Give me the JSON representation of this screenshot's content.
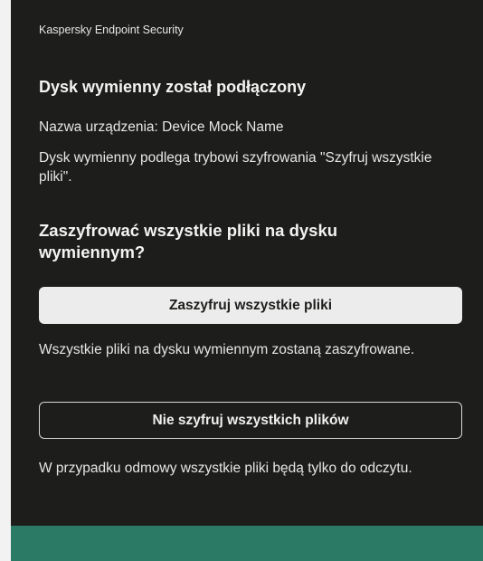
{
  "window": {
    "app_title": "Kaspersky Endpoint Security"
  },
  "notification": {
    "heading": "Dysk wymienny został podłączony",
    "device_name": "Nazwa urządzenia: Device Mock Name",
    "mode_text": "Dysk wymienny podlega trybowi szyfrowania \"Szyfruj wszystkie pliki\".",
    "question": "Zaszyfrować wszystkie pliki na dysku wymiennym?"
  },
  "actions": {
    "encrypt_label": "Zaszyfruj wszystkie pliki",
    "encrypt_note": "Wszystkie pliki na dysku wymiennym zostaną zaszyfrowane.",
    "skip_label": "Nie szyfruj wszystkich plików",
    "skip_note": "W przypadku odmowy wszystkie pliki będą tylko do odczytu."
  },
  "colors": {
    "background": "#1d1d1b",
    "primary_button": "#ececec",
    "footer_accent": "#2a7a66"
  }
}
